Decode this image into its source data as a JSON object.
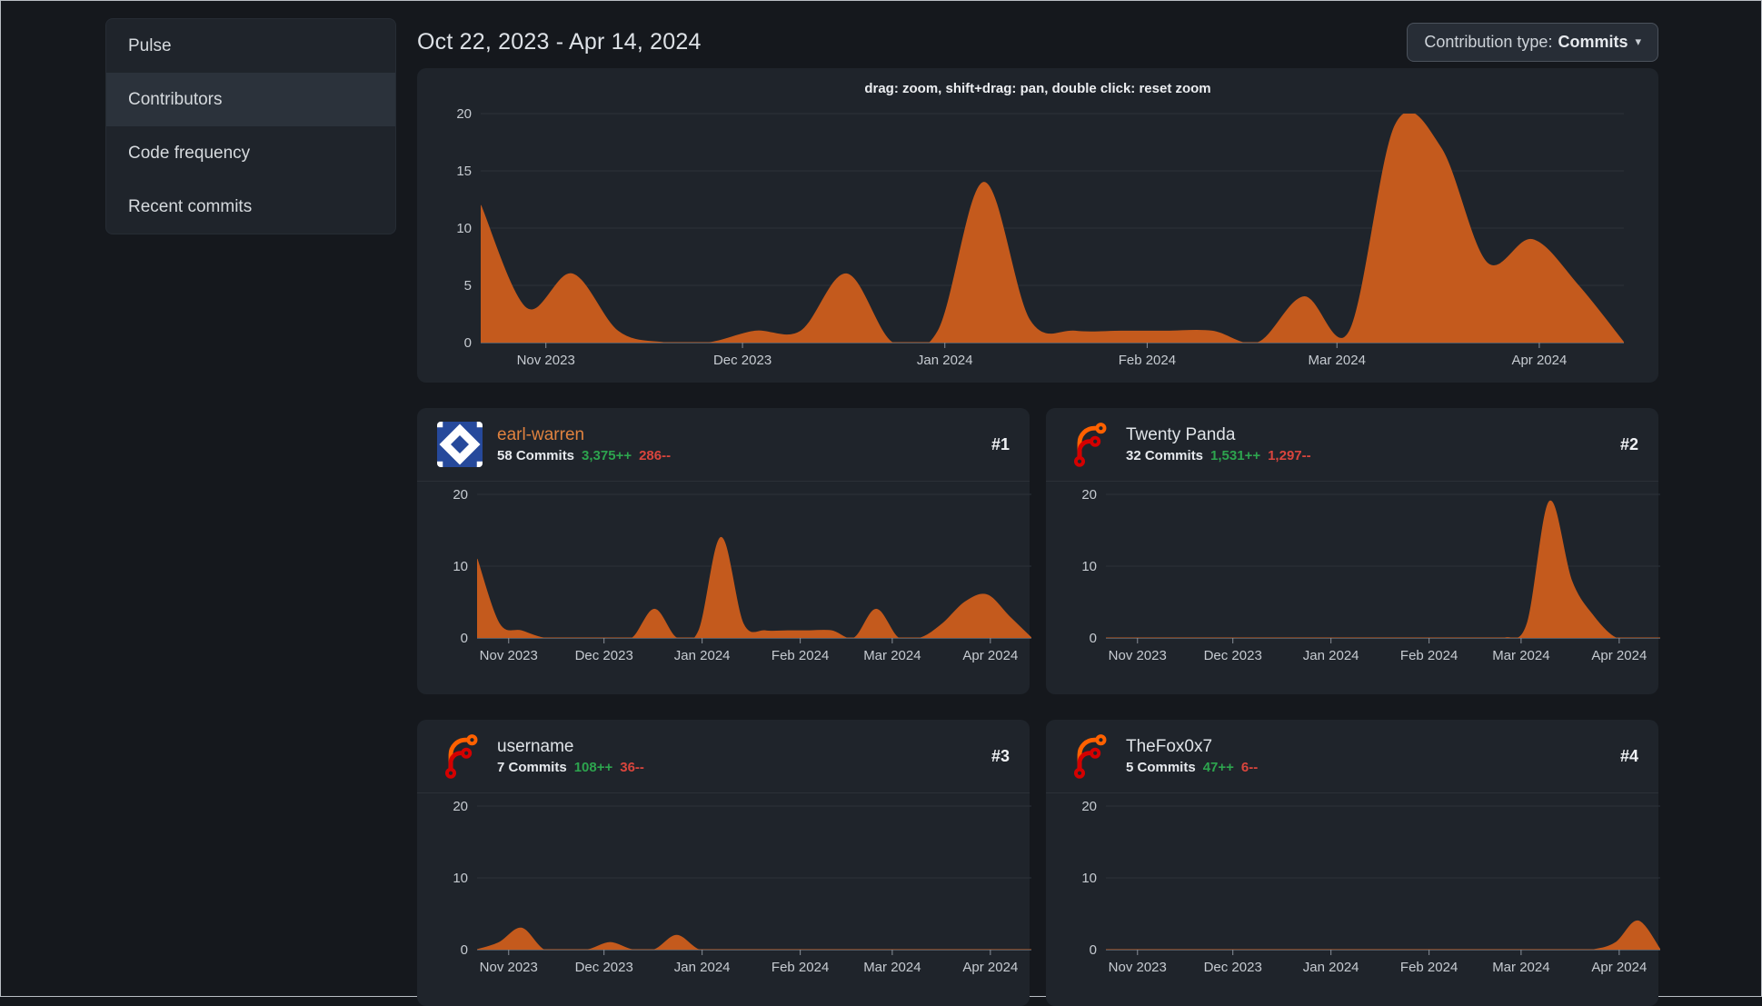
{
  "colors": {
    "chart_fill": "#c45a1d",
    "additions_green": "#2da44e",
    "deletions_red": "#d9453d",
    "link_orange": "#e0823f",
    "panel_bg": "#1f242b",
    "page_bg": "#15181d"
  },
  "sidebar": {
    "items": [
      {
        "label": "Pulse",
        "active": false
      },
      {
        "label": "Contributors",
        "active": true
      },
      {
        "label": "Code frequency",
        "active": false
      },
      {
        "label": "Recent commits",
        "active": false
      }
    ]
  },
  "header": {
    "date_range": "Oct 22, 2023 - Apr 14, 2024",
    "contribution_type": {
      "label": "Contribution type:",
      "value": "Commits"
    },
    "caret_icon": "▾"
  },
  "main_chart_hint": "drag: zoom, shift+drag: pan, double click: reset zoom",
  "contributors": [
    {
      "rank": "#1",
      "name": "earl-warren",
      "commits": "58 Commits",
      "additions": "3,375++",
      "deletions": "286--",
      "avatar": "identicon",
      "link": true
    },
    {
      "rank": "#2",
      "name": "Twenty Panda",
      "commits": "32 Commits",
      "additions": "1,531++",
      "deletions": "1,297--",
      "avatar": "forgejo-logo",
      "link": false
    },
    {
      "rank": "#3",
      "name": "username",
      "commits": "7 Commits",
      "additions": "108++",
      "deletions": "36--",
      "avatar": "forgejo-logo",
      "link": false
    },
    {
      "rank": "#4",
      "name": "TheFox0x7",
      "commits": "5 Commits",
      "additions": "47++",
      "deletions": "6--",
      "avatar": "forgejo-logo",
      "link": false
    }
  ],
  "chart_data": [
    {
      "type": "area",
      "title": "Commits over time (all contributors)",
      "x_start": "2023-10-22",
      "x_end": "2024-04-14",
      "x_interval": "week",
      "values": [
        12,
        3,
        6,
        1,
        0,
        0,
        1,
        1,
        6,
        0,
        1,
        14,
        2,
        1,
        1,
        1,
        1,
        0,
        4,
        1,
        19,
        17,
        7,
        9,
        5,
        0
      ],
      "ylim": [
        0,
        20
      ],
      "yticks": [
        0,
        5,
        10,
        15,
        20
      ],
      "xticks": [
        {
          "label": "Nov 2023",
          "pos": 0.057
        },
        {
          "label": "Dec 2023",
          "pos": 0.229
        },
        {
          "label": "Jan 2024",
          "pos": 0.406
        },
        {
          "label": "Feb 2024",
          "pos": 0.583
        },
        {
          "label": "Mar 2024",
          "pos": 0.749
        },
        {
          "label": "Apr 2024",
          "pos": 0.926
        }
      ],
      "grid": true,
      "legend": "none"
    },
    {
      "type": "area",
      "title": "earl-warren commits",
      "x_start": "2023-10-22",
      "x_end": "2024-04-14",
      "x_interval": "week",
      "values": [
        11,
        2,
        1,
        0,
        0,
        0,
        0,
        0,
        4,
        0,
        1,
        14,
        2,
        1,
        1,
        1,
        1,
        0,
        4,
        0,
        0,
        2,
        5,
        6,
        3,
        0
      ],
      "ylim": [
        0,
        20
      ],
      "yticks": [
        0,
        10,
        20
      ],
      "xticks": [
        {
          "label": "Nov 2023",
          "pos": 0.057
        },
        {
          "label": "Dec 2023",
          "pos": 0.229
        },
        {
          "label": "Jan 2024",
          "pos": 0.406
        },
        {
          "label": "Feb 2024",
          "pos": 0.583
        },
        {
          "label": "Mar 2024",
          "pos": 0.749
        },
        {
          "label": "Apr 2024",
          "pos": 0.926
        }
      ],
      "grid": true,
      "legend": "none"
    },
    {
      "type": "area",
      "title": "Twenty Panda commits",
      "x_start": "2023-10-22",
      "x_end": "2024-04-14",
      "x_interval": "week",
      "values": [
        0,
        0,
        0,
        0,
        0,
        0,
        0,
        0,
        0,
        0,
        0,
        0,
        0,
        0,
        0,
        0,
        0,
        0,
        0,
        2,
        19,
        8,
        3,
        0,
        0,
        0
      ],
      "ylim": [
        0,
        20
      ],
      "yticks": [
        0,
        10,
        20
      ],
      "xticks": [
        {
          "label": "Nov 2023",
          "pos": 0.057
        },
        {
          "label": "Dec 2023",
          "pos": 0.229
        },
        {
          "label": "Jan 2024",
          "pos": 0.406
        },
        {
          "label": "Feb 2024",
          "pos": 0.583
        },
        {
          "label": "Mar 2024",
          "pos": 0.749
        },
        {
          "label": "Apr 2024",
          "pos": 0.926
        }
      ],
      "grid": true,
      "legend": "none"
    },
    {
      "type": "area",
      "title": "username commits",
      "x_start": "2023-10-22",
      "x_end": "2024-04-14",
      "x_interval": "week",
      "values": [
        0,
        1,
        3,
        0,
        0,
        0,
        1,
        0,
        0,
        2,
        0,
        0,
        0,
        0,
        0,
        0,
        0,
        0,
        0,
        0,
        0,
        0,
        0,
        0,
        0,
        0
      ],
      "ylim": [
        0,
        20
      ],
      "yticks": [
        0,
        10,
        20
      ],
      "xticks": [
        {
          "label": "Nov 2023",
          "pos": 0.057
        },
        {
          "label": "Dec 2023",
          "pos": 0.229
        },
        {
          "label": "Jan 2024",
          "pos": 0.406
        },
        {
          "label": "Feb 2024",
          "pos": 0.583
        },
        {
          "label": "Mar 2024",
          "pos": 0.749
        },
        {
          "label": "Apr 2024",
          "pos": 0.926
        }
      ],
      "grid": true,
      "legend": "none"
    },
    {
      "type": "area",
      "title": "TheFox0x7 commits",
      "x_start": "2023-10-22",
      "x_end": "2024-04-14",
      "x_interval": "week",
      "values": [
        0,
        0,
        0,
        0,
        0,
        0,
        0,
        0,
        0,
        0,
        0,
        0,
        0,
        0,
        0,
        0,
        0,
        0,
        0,
        0,
        0,
        0,
        0,
        1,
        4,
        0
      ],
      "ylim": [
        0,
        20
      ],
      "yticks": [
        0,
        10,
        20
      ],
      "xticks": [
        {
          "label": "Nov 2023",
          "pos": 0.057
        },
        {
          "label": "Dec 2023",
          "pos": 0.229
        },
        {
          "label": "Jan 2024",
          "pos": 0.406
        },
        {
          "label": "Feb 2024",
          "pos": 0.583
        },
        {
          "label": "Mar 2024",
          "pos": 0.749
        },
        {
          "label": "Apr 2024",
          "pos": 0.926
        }
      ],
      "grid": true,
      "legend": "none"
    }
  ]
}
